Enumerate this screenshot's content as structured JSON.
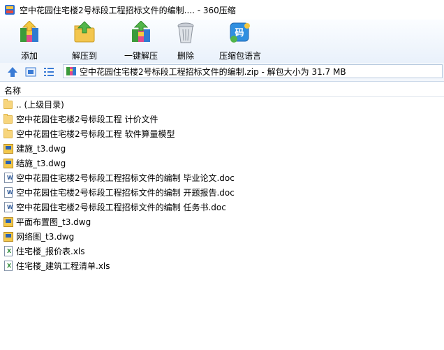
{
  "window": {
    "title": "空中花园住宅楼2号标段工程招标文件的编制.... - 360压缩"
  },
  "toolbar": [
    {
      "label": "添加",
      "icon": "add-archive-icon"
    },
    {
      "label": "解压到",
      "icon": "extract-to-icon"
    },
    {
      "label": "一键解压",
      "icon": "one-click-extract-icon"
    },
    {
      "label": "删除",
      "icon": "delete-icon"
    },
    {
      "label": "压缩包语言",
      "icon": "archive-language-icon",
      "badge": "码"
    }
  ],
  "address": {
    "path": "空中花园住宅楼2号标段工程招标文件的编制.zip - 解包大小为 31.7 MB"
  },
  "list": {
    "column_name": "名称",
    "items": [
      {
        "name": ".. (上级目录)",
        "type": "folder"
      },
      {
        "name": "空中花园住宅楼2号标段工程 计价文件",
        "type": "folder"
      },
      {
        "name": "空中花园住宅楼2号标段工程 软件算量模型",
        "type": "folder"
      },
      {
        "name": "建施_t3.dwg",
        "type": "dwg"
      },
      {
        "name": "结施_t3.dwg",
        "type": "dwg"
      },
      {
        "name": "空中花园住宅楼2号标段工程招标文件的编制 毕业论文.doc",
        "type": "doc"
      },
      {
        "name": "空中花园住宅楼2号标段工程招标文件的编制 开题报告.doc",
        "type": "doc"
      },
      {
        "name": "空中花园住宅楼2号标段工程招标文件的编制 任务书.doc",
        "type": "doc"
      },
      {
        "name": "平面布置图_t3.dwg",
        "type": "dwg"
      },
      {
        "name": "网络图_t3.dwg",
        "type": "dwg"
      },
      {
        "name": "住宅楼_报价表.xls",
        "type": "xls"
      },
      {
        "name": "住宅楼_建筑工程清单.xls",
        "type": "xls"
      }
    ]
  },
  "colors": {
    "folder": "#f7d57d",
    "doc_glyph": "#2b5797",
    "xls_glyph": "#2e8b3a",
    "dwg": "#f3c84b",
    "accent": "#3a7bd5"
  }
}
